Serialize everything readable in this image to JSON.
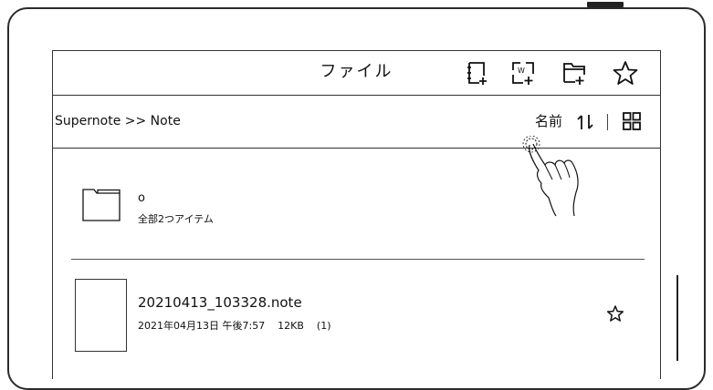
{
  "header": {
    "title": "ファイル",
    "buttons": [
      {
        "name": "new-note-button",
        "icon": "new-notebook-icon"
      },
      {
        "name": "new-document-button",
        "icon": "new-doc-icon",
        "letter": "W"
      },
      {
        "name": "new-folder-button",
        "icon": "new-folder-icon"
      },
      {
        "name": "favorites-button",
        "icon": "star-icon"
      }
    ]
  },
  "pathbar": {
    "breadcrumb": "Supernote >> Note",
    "sort_label": "名前"
  },
  "items": {
    "folder": {
      "name": "o",
      "count": "全部2つアイテム"
    },
    "note": {
      "name": "20210413_103328.note",
      "meta": "2021年04月13日 午後7:57    12KB    (1)"
    }
  },
  "colors": {
    "ink": "#111111",
    "frame": "#2b2b2b",
    "background": "#ffffff"
  }
}
